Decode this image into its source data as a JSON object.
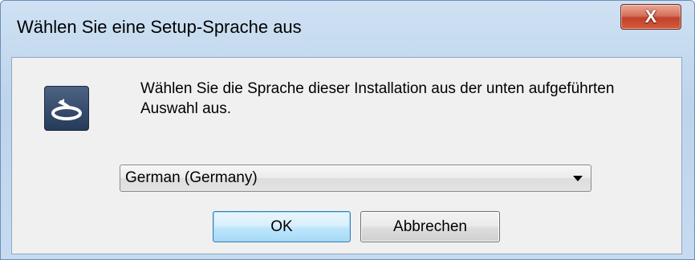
{
  "window": {
    "title": "Wählen Sie eine Setup-Sprache aus",
    "close_glyph": "X"
  },
  "dialog": {
    "icon": "setup-icon",
    "message": "Wählen Sie die Sprache dieser Installation aus der unten aufgeführten Auswahl aus.",
    "language_select": {
      "selected": "German (Germany)"
    },
    "buttons": {
      "ok_label": "OK",
      "cancel_label": "Abbrechen"
    }
  },
  "colors": {
    "title_frame": "#c6dbf0",
    "close_button": "#c0412a",
    "dialog_background": "#f0f0f0",
    "icon_background": "#263a5a",
    "default_button_border": "#3c7fb1"
  }
}
